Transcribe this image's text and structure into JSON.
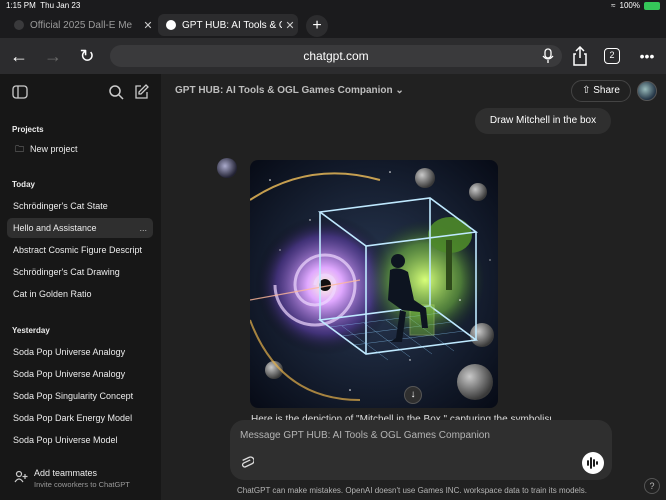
{
  "status_bar": {
    "time": "1:15 PM",
    "date": "Thu Jan 23",
    "battery": "100%"
  },
  "tabs": [
    {
      "label": "Official 2025 Dall-E Me"
    },
    {
      "label": "GPT HUB: AI Tools & OG"
    }
  ],
  "browser": {
    "url": "chatgpt.com",
    "tab_count": "2"
  },
  "sidebar": {
    "projects_header": "Projects",
    "new_project": "New project",
    "today_header": "Today",
    "today": [
      "Schrödinger's Cat State",
      "Hello and Assistance",
      "Abstract Cosmic Figure Descript",
      "Schrödinger's Cat Drawing",
      "Cat in Golden Ratio"
    ],
    "yesterday_header": "Yesterday",
    "yesterday": [
      "Soda Pop Universe Analogy",
      "Soda Pop Universe Analogy",
      "Soda Pop Singularity Concept",
      "Soda Pop Dark Energy Model",
      "Soda Pop Universe Model"
    ],
    "more_icon": "...",
    "add_teammates": "Add teammates",
    "add_teammates_sub": "Invite coworkers to ChatGPT"
  },
  "chat": {
    "gpt_name": "GPT HUB: AI Tools & OGL Games Companion",
    "share_label": "Share",
    "user_message": "Draw Mitchell in the box",
    "response_text": "Here is the depiction of \"Mitchell in the Box,\" capturing the symbolism of",
    "composer_placeholder": "Message GPT HUB: AI Tools & OGL Games Companion",
    "disclaimer": "ChatGPT can make mistakes. OpenAI doesn't use Games INC. workspace data to train its models.",
    "help": "?"
  },
  "colors": {
    "accent_green": "#9be15d",
    "cube_edge": "#bfe9ff",
    "background": "#212121",
    "sidebar": "#171717"
  }
}
